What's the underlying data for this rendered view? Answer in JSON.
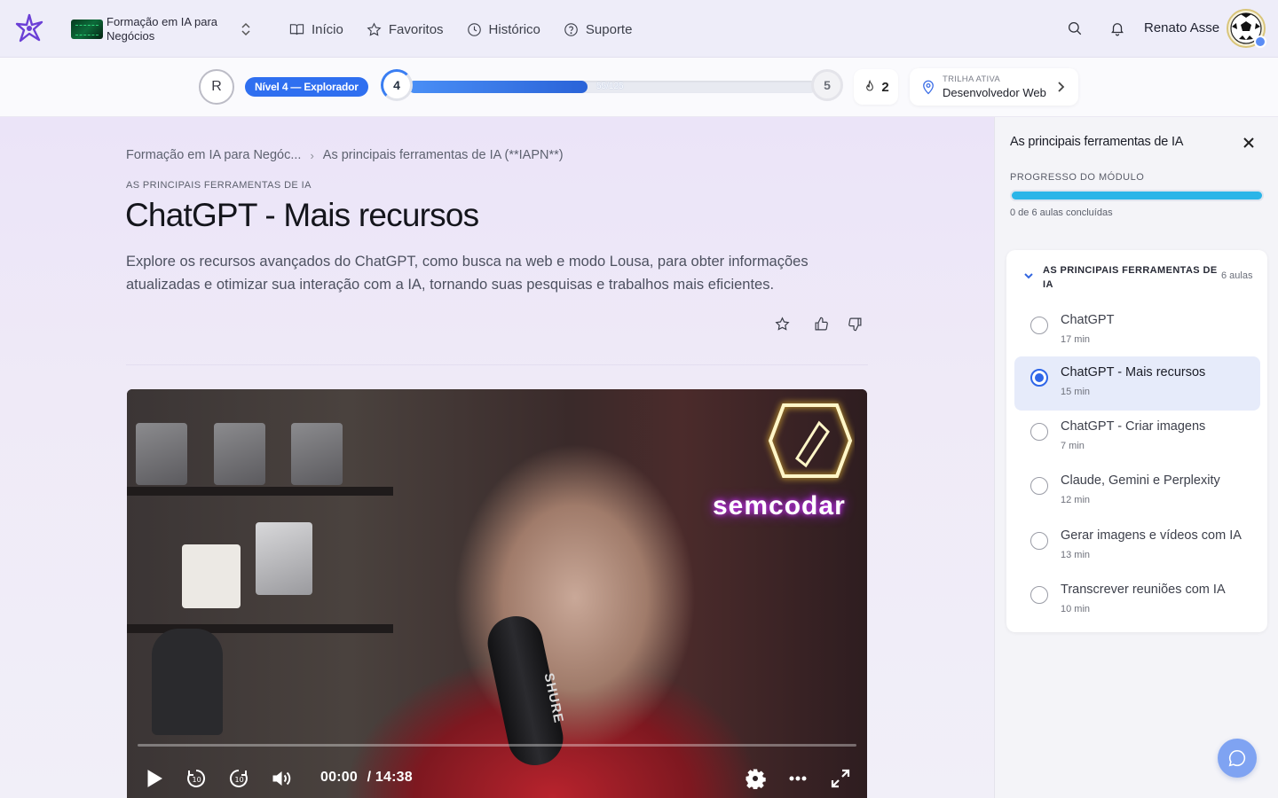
{
  "nav": {
    "course_name": "Formação em IA para Negócios",
    "links": [
      {
        "label": "Início",
        "icon": "book-open-icon"
      },
      {
        "label": "Favoritos",
        "icon": "star-icon"
      },
      {
        "label": "Histórico",
        "icon": "clock-icon"
      },
      {
        "label": "Suporte",
        "icon": "help-circle-icon"
      }
    ],
    "user_name": "Renato Asse"
  },
  "progress": {
    "avatar_initial": "R",
    "level_label": "Nível 4 — Explorador",
    "current_level": "4",
    "next_level": "5",
    "xp_text": "55/125",
    "xp_fraction": 0.44,
    "streak": "2",
    "trail_label": "TRILHA ATIVA",
    "trail_value": "Desenvolvedor Web"
  },
  "lesson": {
    "breadcrumb": [
      "Formação em IA para Negóc...",
      "As principais ferramentas de IA (**IAPN**)"
    ],
    "eyebrow": "AS PRINCIPAIS FERRAMENTAS DE IA",
    "title": "ChatGPT - Mais recursos",
    "description": "Explore os recursos avançados do ChatGPT, como busca na web e modo Lousa, para obter informações atualizadas e otimizar sua interação com a IA, tornando suas pesquisas e trabalhos mais eficientes."
  },
  "video": {
    "current_time": "00:00",
    "duration": "/ 14:38",
    "neon_text": "semcodar",
    "mic_brand": "SHURE"
  },
  "sidebar": {
    "title": "As principais ferramentas de IA",
    "progress_label": "PROGRESSO DO MÓDULO",
    "progress_text": "0 de 6 aulas concluídas",
    "module_title": "AS PRINCIPAIS FERRAMENTAS DE IA",
    "module_count": "6 aulas",
    "lessons": [
      {
        "title": "ChatGPT",
        "duration": "17 min"
      },
      {
        "title": "ChatGPT - Mais recursos",
        "duration": "15 min"
      },
      {
        "title": "ChatGPT - Criar imagens",
        "duration": "7 min"
      },
      {
        "title": "Claude, Gemini e Perplexity",
        "duration": "12 min"
      },
      {
        "title": "Gerar imagens e vídeos com IA",
        "duration": "13 min"
      },
      {
        "title": "Transcrever reuniões com IA",
        "duration": "10 min"
      }
    ]
  },
  "colors": {
    "accent": "#2f6ff0",
    "module_progress": "#2ab5e8"
  }
}
